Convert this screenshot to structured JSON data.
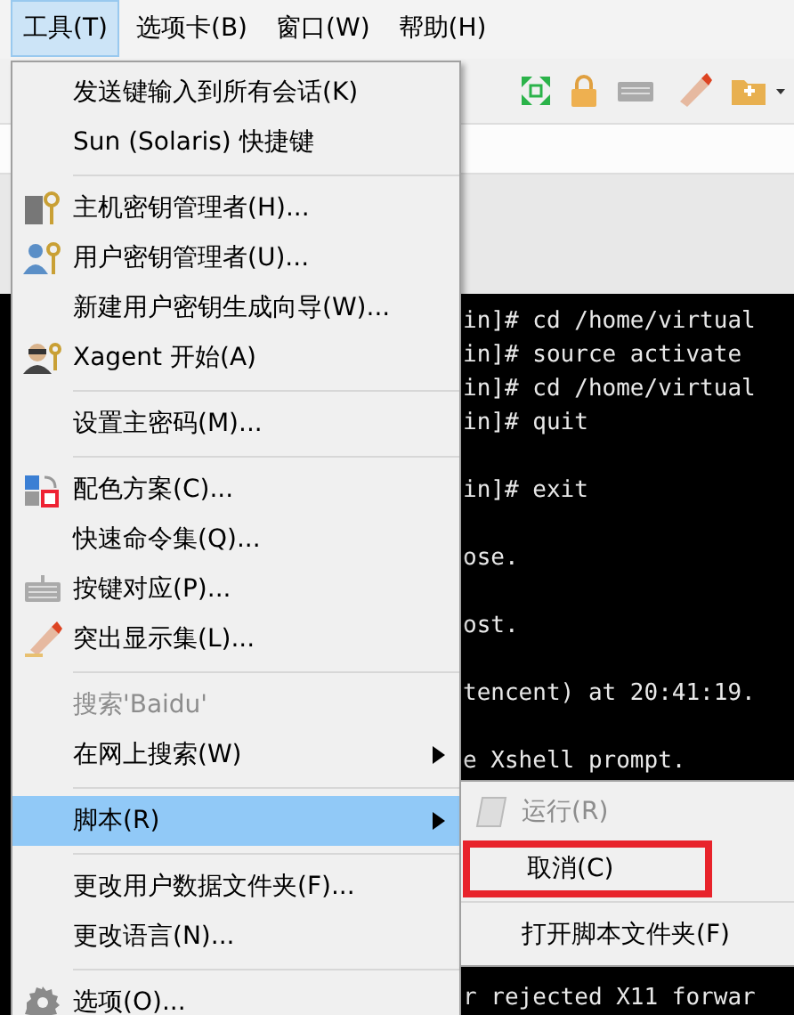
{
  "menu_bar": [
    {
      "label": "工具(T)",
      "selected": true
    },
    {
      "label": "选项卡(B)",
      "selected": false
    },
    {
      "label": "窗口(W)",
      "selected": false
    },
    {
      "label": "帮助(H)",
      "selected": false
    }
  ],
  "terminal": {
    "lines": [
      {
        "kind": "text",
        "text": "in]# cd /home/virtual"
      },
      {
        "kind": "text",
        "text": "in]# source activate"
      },
      {
        "kind": "text",
        "text": "in]# cd /home/virtual"
      },
      {
        "kind": "text",
        "text": "in]# quit"
      },
      {
        "kind": "blank"
      },
      {
        "kind": "text",
        "text": "in]# exit"
      },
      {
        "kind": "blank"
      },
      {
        "kind": "text",
        "text": "ose."
      },
      {
        "kind": "blank"
      },
      {
        "kind": "text",
        "text": "ost."
      },
      {
        "kind": "blank"
      },
      {
        "kind": "text",
        "text": "tencent) at 20:41:19."
      },
      {
        "kind": "blank"
      },
      {
        "kind": "text",
        "text": "e Xshell prompt."
      },
      {
        "kind": "blank"
      },
      {
        "kind": "blank"
      },
      {
        "kind": "blank"
      },
      {
        "kind": "blank"
      },
      {
        "kind": "blank"
      },
      {
        "kind": "blank"
      },
      {
        "kind": "text",
        "text": "r rejected X11 forwar"
      }
    ]
  },
  "tools_menu": [
    {
      "kind": "item",
      "label": "发送键输入到所有会话(K)",
      "disabled": false,
      "selected": false,
      "submenu": false
    },
    {
      "kind": "item",
      "label": "Sun (Solaris) 快捷键",
      "disabled": false,
      "selected": false,
      "submenu": false
    },
    {
      "kind": "separator"
    },
    {
      "kind": "item",
      "label": "主机密钥管理者(H)...",
      "disabled": false,
      "selected": false,
      "submenu": false
    },
    {
      "kind": "item",
      "label": "用户密钥管理者(U)...",
      "disabled": false,
      "selected": false,
      "submenu": false
    },
    {
      "kind": "item",
      "label": "新建用户密钥生成向导(W)...",
      "disabled": false,
      "selected": false,
      "submenu": false
    },
    {
      "kind": "item",
      "label": "Xagent 开始(A)",
      "disabled": false,
      "selected": false,
      "submenu": false
    },
    {
      "kind": "separator"
    },
    {
      "kind": "item",
      "label": "设置主密码(M)...",
      "disabled": false,
      "selected": false,
      "submenu": false
    },
    {
      "kind": "separator"
    },
    {
      "kind": "item",
      "label": "配色方案(C)...",
      "disabled": false,
      "selected": false,
      "submenu": false
    },
    {
      "kind": "item",
      "label": "快速命令集(Q)...",
      "disabled": false,
      "selected": false,
      "submenu": false
    },
    {
      "kind": "item",
      "label": "按键对应(P)...",
      "disabled": false,
      "selected": false,
      "submenu": false
    },
    {
      "kind": "item",
      "label": "突出显示集(L)...",
      "disabled": false,
      "selected": false,
      "submenu": false
    },
    {
      "kind": "separator"
    },
    {
      "kind": "item",
      "label": "搜索'Baidu'",
      "disabled": true,
      "selected": false,
      "submenu": false
    },
    {
      "kind": "item",
      "label": "在网上搜索(W)",
      "disabled": false,
      "selected": false,
      "submenu": true
    },
    {
      "kind": "separator"
    },
    {
      "kind": "item",
      "label": "脚本(R)",
      "disabled": false,
      "selected": true,
      "submenu": true
    },
    {
      "kind": "separator"
    },
    {
      "kind": "item",
      "label": "更改用户数据文件夹(F)...",
      "disabled": false,
      "selected": false,
      "submenu": false
    },
    {
      "kind": "item",
      "label": "更改语言(N)...",
      "disabled": false,
      "selected": false,
      "submenu": false
    },
    {
      "kind": "separator"
    },
    {
      "kind": "item",
      "label": "选项(O)...",
      "disabled": false,
      "selected": false,
      "submenu": false
    }
  ],
  "script_submenu": [
    {
      "kind": "item",
      "label": "运行(R)",
      "disabled": true,
      "annotated": false
    },
    {
      "kind": "item",
      "label": "取消(C)",
      "disabled": false,
      "annotated": true
    },
    {
      "kind": "separator"
    },
    {
      "kind": "item",
      "label": "打开脚本文件夹(F)",
      "disabled": false,
      "annotated": false
    }
  ]
}
